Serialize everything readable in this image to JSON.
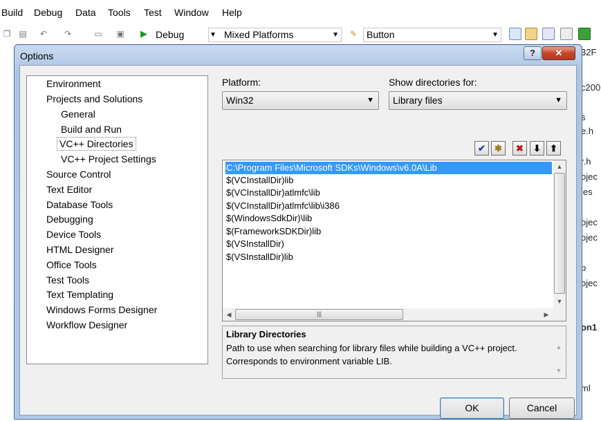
{
  "menubar": {
    "items": [
      "Build",
      "Debug",
      "Data",
      "Tools",
      "Test",
      "Window",
      "Help"
    ]
  },
  "toolbar": {
    "config_combo": "Debug",
    "platform_combo": "Mixed Platforms",
    "find_combo": "Button",
    "icons": [
      "copy-icon",
      "paste-icon",
      "undo-icon",
      "redo-icon",
      "nav-icon",
      "nav-icon-2",
      "start-debug-icon",
      "find-icon",
      "solution-explorer-icon",
      "properties-icon",
      "object-browser-icon",
      "toolbox-icon",
      "start-page-icon"
    ]
  },
  "background_fragments": [
    "32F",
    "c200",
    "s",
    "e.h",
    "r.h",
    "ojec",
    "les",
    "ojec",
    "ojec",
    "p",
    "ojec",
    "on1",
    "ml"
  ],
  "dialog": {
    "title": "Options",
    "help_button": "?",
    "close_button": "✕",
    "tree": [
      "Environment",
      "Projects and Solutions",
      "General",
      "Build and Run",
      "VC++ Directories",
      "VC++ Project Settings",
      "Source Control",
      "Text Editor",
      "Database Tools",
      "Debugging",
      "Device Tools",
      "HTML Designer",
      "Office Tools",
      "Test Tools",
      "Text Templating",
      "Windows Forms Designer",
      "Workflow Designer"
    ],
    "selected_tree_item": "VC++ Directories",
    "platform_label": "Platform:",
    "platform_value": "Win32",
    "show_dirs_label": "Show directories for:",
    "show_dirs_value": "Library files",
    "list_buttons": [
      {
        "icon": "checkmark-icon",
        "glyph": "✔",
        "color": "#1f3fa8"
      },
      {
        "icon": "new-folder-icon",
        "glyph": "✱",
        "color": "#9b7a12"
      },
      {
        "icon": "delete-icon",
        "glyph": "✖",
        "color": "#c0171b"
      },
      {
        "icon": "move-down-icon",
        "glyph": "⬇",
        "color": "#000000"
      },
      {
        "icon": "move-up-icon",
        "glyph": "⬆",
        "color": "#000000"
      }
    ],
    "directories": [
      "C:\\Program Files\\Microsoft SDKs\\Windows\\v6.0A\\Lib",
      "$(VCInstallDir)lib",
      "$(VCInstallDir)atlmfc\\lib",
      "$(VCInstallDir)atlmfc\\lib\\i386",
      "$(WindowsSdkDir)\\lib",
      "$(FrameworkSDKDir)lib",
      "$(VSInstallDir)",
      "$(VSInstallDir)lib"
    ],
    "selected_directory_index": 0,
    "description_title": "Library Directories",
    "description_text": "Path to use when searching for library files while building a VC++ project.  Corresponds to environment variable LIB.",
    "ok_label": "OK",
    "cancel_label": "Cancel",
    "colors": {
      "selection": "#3399ff",
      "close_button": "#c5452b",
      "title_gradient": "#aac4e4"
    }
  }
}
